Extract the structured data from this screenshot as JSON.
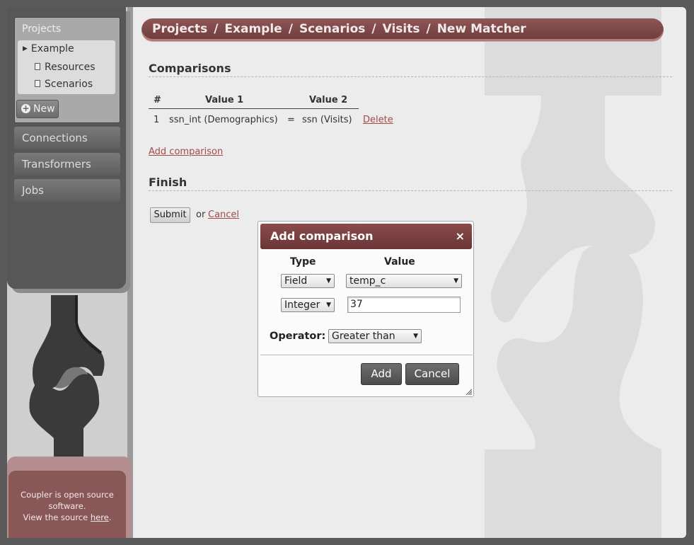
{
  "sidebar": {
    "projects_title": "Projects",
    "tree": [
      {
        "label": "Example",
        "icon": "caret-right-icon"
      },
      {
        "label": "Resources",
        "icon": "document-icon"
      },
      {
        "label": "Scenarios",
        "icon": "document-icon"
      }
    ],
    "new_label": "New",
    "nav": [
      {
        "label": "Connections"
      },
      {
        "label": "Transformers"
      },
      {
        "label": "Jobs"
      }
    ],
    "footer": {
      "line1": "Coupler is open source",
      "line2": "software.",
      "line3_prefix": "View the source",
      "link": "here",
      "line3_suffix": "."
    }
  },
  "breadcrumb": {
    "items": [
      "Projects",
      "Example",
      "Scenarios",
      "Visits",
      "New Matcher"
    ],
    "separator": "/"
  },
  "comparisons": {
    "heading": "Comparisons",
    "columns": [
      "#",
      "Value 1",
      "Value 2"
    ],
    "rows": [
      {
        "num": "1",
        "value1": "ssn_int (Demographics)",
        "op": "=",
        "value2": "ssn (Visits)",
        "action": "Delete"
      }
    ],
    "add_link": "Add comparison"
  },
  "finish": {
    "heading": "Finish",
    "submit": "Submit",
    "or": "or",
    "cancel": "Cancel"
  },
  "dialog": {
    "title": "Add comparison",
    "close": "×",
    "type_header": "Type",
    "value_header": "Value",
    "row1": {
      "type": "Field",
      "value": "temp_c"
    },
    "row2": {
      "type": "Integer",
      "value": "37"
    },
    "operator_label": "Operator:",
    "operator_value": "Greater than",
    "add": "Add",
    "cancel": "Cancel"
  },
  "colors": {
    "accent": "#7c4545",
    "link": "#a24a4a",
    "sidebar_dark": "#575757",
    "footer": "#8a5757"
  }
}
